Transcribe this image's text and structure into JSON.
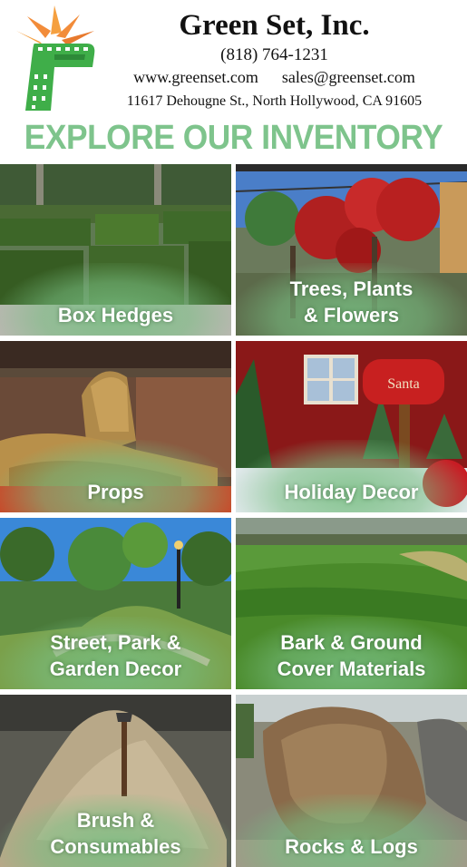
{
  "header": {
    "company_name": "Green Set, Inc.",
    "phone": "(818) 764-1231",
    "website": "www.greenset.com",
    "email": "sales@greenset.com",
    "address": "11617 Dehougne St., North Hollywood, CA 91605"
  },
  "headline": "EXPLORE OUR INVENTORY",
  "colors": {
    "headline": "#7ec48c",
    "label_glow": "#78be82",
    "logo_green": "#3fae49",
    "logo_orange": "#f28c3a"
  },
  "tiles": [
    {
      "line1": "Box Hedges",
      "line2": ""
    },
    {
      "line1": "Trees, Plants",
      "line2": "& Flowers"
    },
    {
      "line1": "Props",
      "line2": ""
    },
    {
      "line1": "Holiday Decor",
      "line2": ""
    },
    {
      "line1": "Street, Park &",
      "line2": "Garden Decor"
    },
    {
      "line1": "Bark & Ground",
      "line2": "Cover Materials"
    },
    {
      "line1": "Brush &",
      "line2": "Consumables"
    },
    {
      "line1": "Rocks & Logs",
      "line2": ""
    }
  ],
  "holiday_sign": "Santa"
}
